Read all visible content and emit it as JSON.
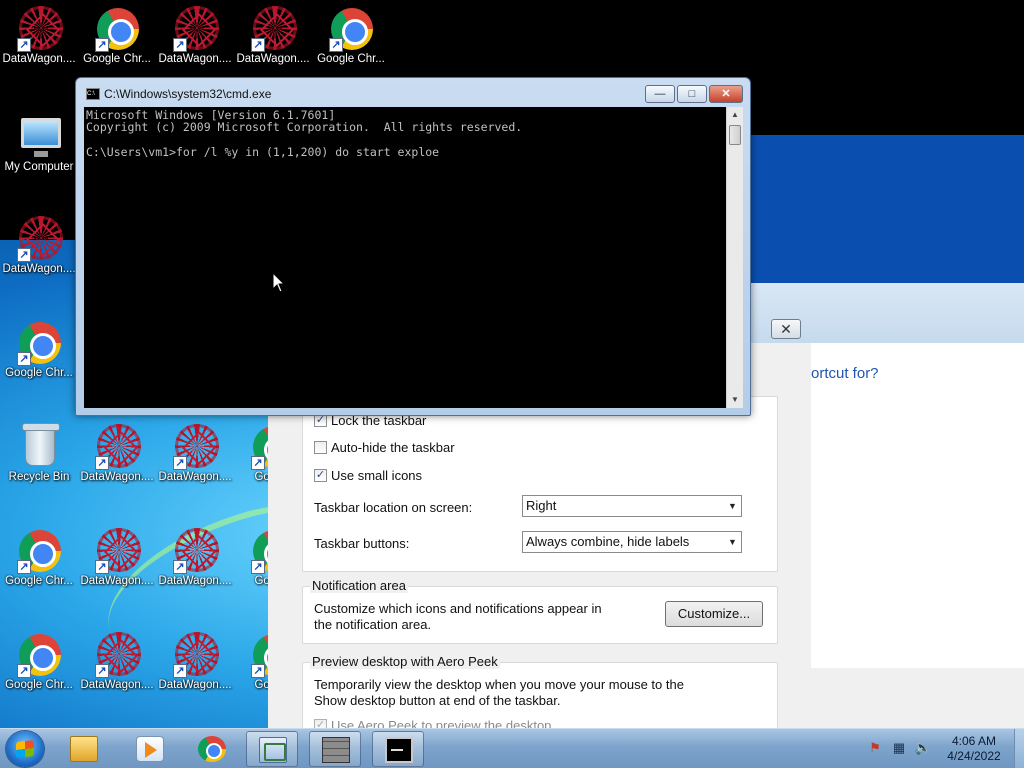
{
  "desktop": {
    "icons_top_row": [
      {
        "label": "DataWagon....",
        "kind": "datawagon"
      },
      {
        "label": "Google Chr...",
        "kind": "chrome"
      },
      {
        "label": "DataWagon....",
        "kind": "datawagon"
      },
      {
        "label": "DataWagon....",
        "kind": "datawagon"
      },
      {
        "label": "Google Chr...",
        "kind": "chrome"
      }
    ],
    "icons_left_column": [
      {
        "label": "My Computer",
        "kind": "computer"
      },
      {
        "label": "DataWagon....",
        "kind": "datawagon"
      },
      {
        "label": "Google Chr...",
        "kind": "chrome"
      },
      {
        "label": "Recycle Bin",
        "kind": "recycle-bin"
      },
      {
        "label": "Google Chr...",
        "kind": "chrome"
      },
      {
        "label": "Google Chr...",
        "kind": "chrome"
      }
    ],
    "icons_grid": [
      {
        "label": "DataWagon....",
        "kind": "datawagon"
      },
      {
        "label": "DataWagon....",
        "kind": "datawagon"
      },
      {
        "label": "Google",
        "kind": "chrome"
      },
      {
        "label": "DataWagon....",
        "kind": "datawagon"
      },
      {
        "label": "DataWagon....",
        "kind": "datawagon"
      },
      {
        "label": "Google",
        "kind": "chrome"
      },
      {
        "label": "DataWagon....",
        "kind": "datawagon"
      },
      {
        "label": "DataWagon....",
        "kind": "datawagon"
      },
      {
        "label": "Google",
        "kind": "chrome"
      }
    ]
  },
  "cmd_window": {
    "title": "C:\\Windows\\system32\\cmd.exe",
    "minimize_label": "—",
    "maximize_label": "□",
    "close_label": "✕",
    "console_lines": [
      "Microsoft Windows [Version 6.1.7601]",
      "Copyright (c) 2009 Microsoft Corporation.  All rights reserved.",
      "",
      "C:\\Users\\vm1>for /l %y in (1,1,200) do start exploe"
    ]
  },
  "taskbar_dialog": {
    "close_label": "✕",
    "right_prompt": "ortcut for?",
    "lock_taskbar": {
      "label": "Lock the taskbar",
      "checked": true
    },
    "auto_hide": {
      "label": "Auto-hide the taskbar",
      "checked": false
    },
    "small_icons": {
      "label": "Use small icons",
      "checked": true
    },
    "location_label": "Taskbar location on screen:",
    "location_value": "Right",
    "buttons_label": "Taskbar buttons:",
    "buttons_value": "Always combine, hide labels",
    "notification": {
      "title": "Notification area",
      "text_line1": "Customize which icons and notifications appear in",
      "text_line2": "the notification area.",
      "customize_label": "Customize..."
    },
    "aero_peek": {
      "title": "Preview desktop with Aero Peek",
      "text_line1": "Temporarily view the desktop when you move your mouse to the",
      "text_line2": "Show desktop button at end of the taskbar.",
      "checkbox_label": "Use Aero Peek to preview the desktop"
    }
  },
  "taskbar": {
    "pinned": [
      {
        "name": "explorer",
        "open": false
      },
      {
        "name": "media-player",
        "open": false
      },
      {
        "name": "chrome",
        "open": false
      },
      {
        "name": "control-panel",
        "open": true
      },
      {
        "name": "firewall",
        "open": true
      },
      {
        "name": "cmd",
        "open": true
      }
    ],
    "clock_time": "4:06 AM",
    "clock_date": "4/24/2022"
  },
  "colors": {
    "taskbar": "#7ea4cc",
    "console_bg": "#000000",
    "console_text": "#c0c0c0",
    "link_blue": "#1e56b0"
  }
}
